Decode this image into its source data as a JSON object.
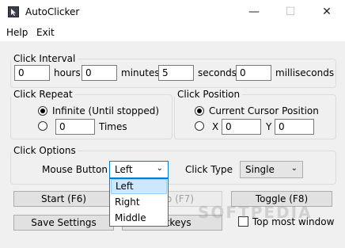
{
  "window": {
    "title": "AutoClicker",
    "minimize": "—",
    "maximize": "☐",
    "close": "✕"
  },
  "menu": {
    "help": "Help",
    "exit": "Exit"
  },
  "click_interval": {
    "legend": "Click Interval",
    "hours_value": "0",
    "hours_label": "hours",
    "minutes_value": "0",
    "minutes_label": "minutes",
    "seconds_value": "5",
    "seconds_label": "seconds",
    "ms_value": "0",
    "ms_label": "milliseconds"
  },
  "click_repeat": {
    "legend": "Click Repeat",
    "infinite_label": "Infinite (Until stopped)",
    "times_value": "0",
    "times_label": "Times"
  },
  "click_position": {
    "legend": "Click Position",
    "current_label": "Current Cursor Position",
    "x_label": "X",
    "x_value": "0",
    "y_label": "Y",
    "y_value": "0"
  },
  "click_options": {
    "legend": "Click Options",
    "mouse_button_label": "Mouse Button",
    "mouse_button_value": "Left",
    "mouse_button_options": [
      "Left",
      "Right",
      "Middle"
    ],
    "click_type_label": "Click Type",
    "click_type_value": "Single"
  },
  "buttons": {
    "start": "Start (F6)",
    "stop": "Stop (F7)",
    "toggle": "Toggle (F8)",
    "save": "Save Settings",
    "hotkeys": "Hotkeys",
    "topmost": "Top most window"
  },
  "watermark": "SOFTPEDIA"
}
